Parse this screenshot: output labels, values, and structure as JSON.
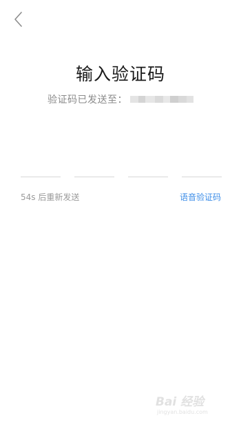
{
  "header": {
    "back_icon": "chevron-left-icon"
  },
  "main": {
    "title": "输入验证码",
    "subtitle": "验证码已发送至："
  },
  "code_input": {
    "digits": [
      "",
      "",
      "",
      ""
    ]
  },
  "footer_row": {
    "resend_text": "54s 后重新发送",
    "voice_code_label": "语音验证码",
    "link_color": "#3d8ee8"
  },
  "watermark": {
    "brand": "Bai 经验",
    "url": "jingyan.baidu.com"
  }
}
